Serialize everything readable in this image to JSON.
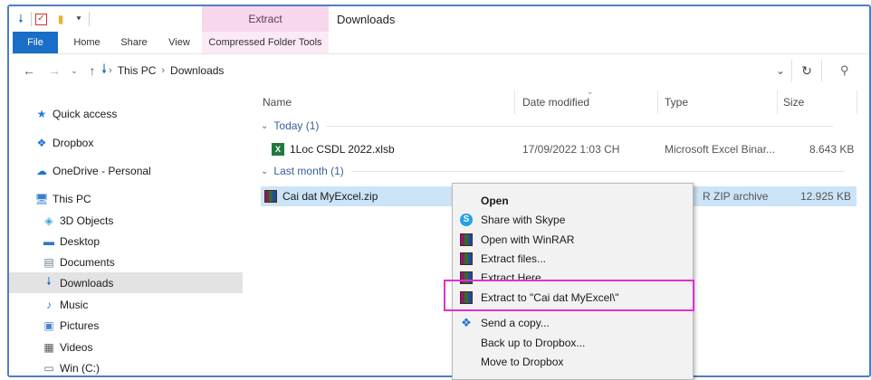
{
  "window": {
    "title": "Downloads",
    "contextual_tab_group": "Extract"
  },
  "quick_access_toolbar": {
    "icons": [
      "download-arrow-icon",
      "properties-check-icon",
      "folder-icon",
      "customize-dropdown-icon"
    ]
  },
  "ribbon": {
    "tabs": [
      {
        "label": "File"
      },
      {
        "label": "Home"
      },
      {
        "label": "Share"
      },
      {
        "label": "View"
      },
      {
        "label": "Compressed Folder Tools"
      }
    ]
  },
  "address_bar": {
    "breadcrumbs": [
      "This PC",
      "Downloads"
    ],
    "search_icon": "search-icon"
  },
  "sidebar": {
    "items": [
      {
        "label": "Quick access",
        "icon": "star-icon"
      },
      {
        "label": "Dropbox",
        "icon": "dropbox-icon"
      },
      {
        "label": "OneDrive - Personal",
        "icon": "cloud-icon"
      },
      {
        "label": "This PC",
        "icon": "computer-icon"
      },
      {
        "label": "3D Objects",
        "icon": "cube-icon"
      },
      {
        "label": "Desktop",
        "icon": "desktop-icon"
      },
      {
        "label": "Documents",
        "icon": "documents-icon"
      },
      {
        "label": "Downloads",
        "icon": "download-arrow-icon",
        "selected": true
      },
      {
        "label": "Music",
        "icon": "music-note-icon"
      },
      {
        "label": "Pictures",
        "icon": "pictures-icon"
      },
      {
        "label": "Videos",
        "icon": "videos-icon"
      },
      {
        "label": "Win (C:)",
        "icon": "drive-icon"
      }
    ]
  },
  "file_list": {
    "columns": [
      "Name",
      "Date modified",
      "Type",
      "Size"
    ],
    "groups": [
      {
        "label": "Today (1)",
        "files": [
          {
            "name": "1Loc CSDL 2022.xlsb",
            "date": "17/09/2022 1:03 CH",
            "type": "Microsoft Excel Binar...",
            "size": "8.643 KB",
            "icon": "excel-icon"
          }
        ]
      },
      {
        "label": "Last month (1)",
        "files": [
          {
            "name": "Cai dat MyExcel.zip",
            "date": "",
            "type": "R ZIP archive",
            "size": "12.925 KB",
            "icon": "winrar-icon",
            "selected": true
          }
        ]
      }
    ]
  },
  "context_menu": {
    "items": [
      {
        "label": "Open",
        "bold": true,
        "icon": ""
      },
      {
        "label": "Share with Skype",
        "icon": "skype-icon"
      },
      {
        "label": "Open with WinRAR",
        "icon": "winrar-icon"
      },
      {
        "label": "Extract files...",
        "icon": "winrar-icon"
      },
      {
        "label": "Extract Here",
        "icon": "winrar-icon"
      },
      {
        "label": "Extract to \"Cai dat MyExcel\\\"",
        "icon": "winrar-icon",
        "highlighted": true
      },
      {
        "label": "Send a copy...",
        "icon": "dropbox-icon"
      },
      {
        "label": "Back up to Dropbox...",
        "icon": ""
      },
      {
        "label": "Move to Dropbox",
        "icon": ""
      }
    ]
  },
  "colors": {
    "file_tab": "#1a6ec7",
    "contextual_tab": "#f7d7ec",
    "selection": "#cce4f7",
    "highlight_border": "#e12fd2",
    "group_header": "#36609b"
  }
}
